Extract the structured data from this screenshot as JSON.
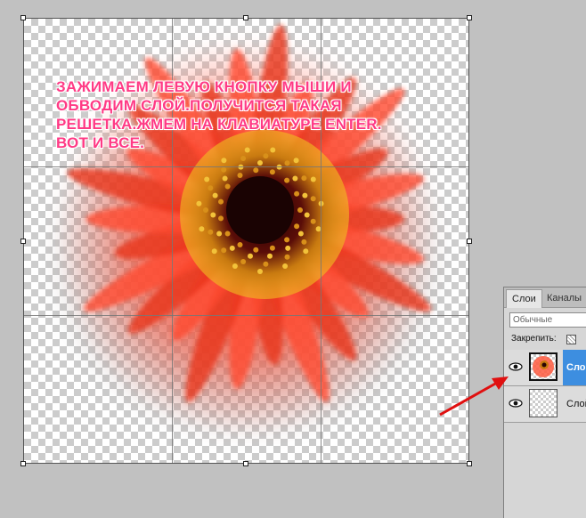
{
  "canvas": {
    "instruction_lines": [
      "ЗАЖИМАЕМ ЛЕВУЮ КНОПКУ МЫШИ И",
      "ОБВОДИМ СЛОЙ.ПОЛУЧИТСЯ ТАКАЯ",
      "РЕШЕТКА.ЖМЕМ НА КЛАВИАТУРЕ ENTER.",
      "ВОТ И ВСЕ."
    ],
    "text_color": "#ff3a85",
    "grid_divisions": 3
  },
  "layers_panel": {
    "tabs": [
      {
        "label": "Слои"
      },
      {
        "label": "Каналы"
      }
    ],
    "blend_mode": "Обычные",
    "lock_label": "Закрепить:",
    "layers": [
      {
        "name": "Слой",
        "selected": true,
        "thumb": "flower"
      },
      {
        "name": "Слой",
        "selected": false,
        "thumb": "empty"
      }
    ],
    "selection_color": "#3d8ee0"
  },
  "annotation": {
    "arrow_color": "#e01010"
  }
}
